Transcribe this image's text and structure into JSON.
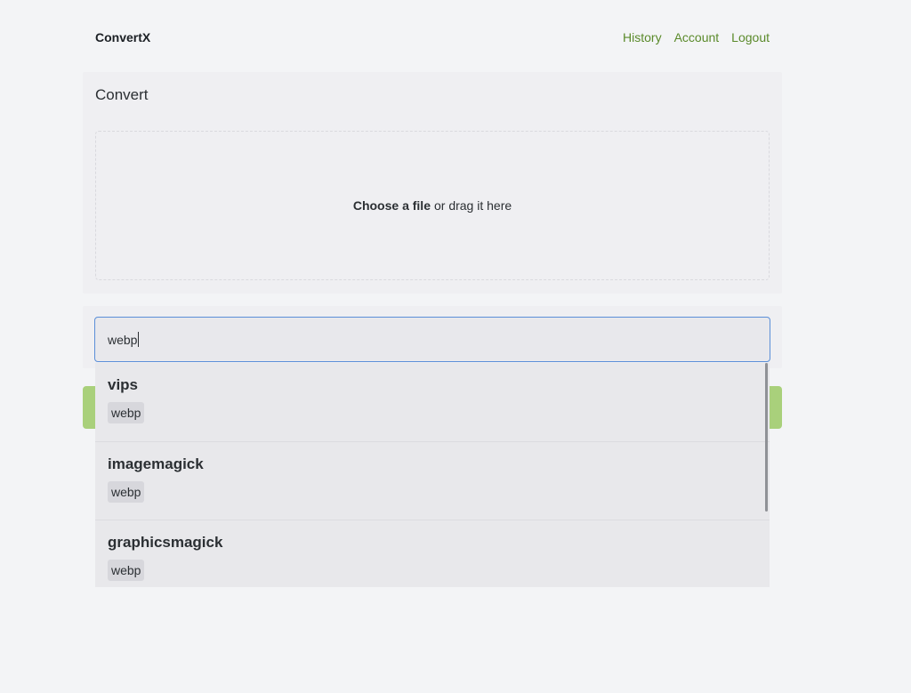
{
  "header": {
    "brand": "ConvertX",
    "nav": [
      {
        "label": "History"
      },
      {
        "label": "Account"
      },
      {
        "label": "Logout"
      }
    ],
    "link_color": "#5a8a2a"
  },
  "convert": {
    "title": "Convert",
    "dropzone": {
      "choose_label": "Choose a file",
      "drag_label": "or drag it here"
    }
  },
  "search": {
    "value": "webp"
  },
  "results": [
    {
      "converter": "vips",
      "format": "webp"
    },
    {
      "converter": "imagemagick",
      "format": "webp"
    },
    {
      "converter": "graphicsmagick",
      "format": "webp"
    }
  ],
  "colors": {
    "accent_button": "#a9d07b",
    "focus_border": "#5b8fd8"
  }
}
